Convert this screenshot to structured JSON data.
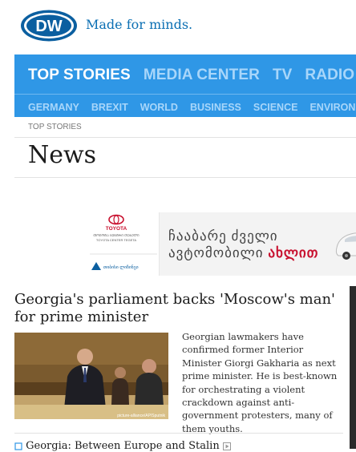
{
  "brand": {
    "logo_text": "DW",
    "tagline": "Made for minds."
  },
  "nav": {
    "main": [
      "TOP STORIES",
      "MEDIA CENTER",
      "TV",
      "RADIO"
    ],
    "sub": [
      "GERMANY",
      "BREXIT",
      "WORLD",
      "BUSINESS",
      "SCIENCE",
      "ENVIRON"
    ]
  },
  "breadcrumb": "TOP STORIES",
  "page_title": "News",
  "ad": {
    "brand": "TOYOTA",
    "brand_sub1": "ᲗᲝᲘᲝᲢᲐ ᲪᲔᲜᲢᲠᲘ ᲗᲔᲑᲔᲚᲘ",
    "brand_sub2": "TOYOTA CENTER TEGETA",
    "footer": "თიბისი ლიზინგი",
    "line1": "ჩააბარე ძველი",
    "line2_prefix": "ავტომობილი ",
    "line2_highlight": "ახლით"
  },
  "article": {
    "headline": "Georgia's parliament backs 'Moscow's man' for prime minister",
    "teaser": "Georgian lawmakers have confirmed former Interior Minister Giorgi Gakharia as next prime minister. He is best-known for orchestrating a violent crackdown against anti-government protesters, many of them youths.",
    "photo_credit": "picture-alliance/AP/Sputnik"
  },
  "related": {
    "title": "Georgia: Between Europe and Stalin"
  },
  "colors": {
    "nav_bg": "#2f97e6",
    "nav_active": "#ffffff",
    "nav_inactive": "#a8d6fa",
    "brand_blue": "#0b6fb3"
  }
}
